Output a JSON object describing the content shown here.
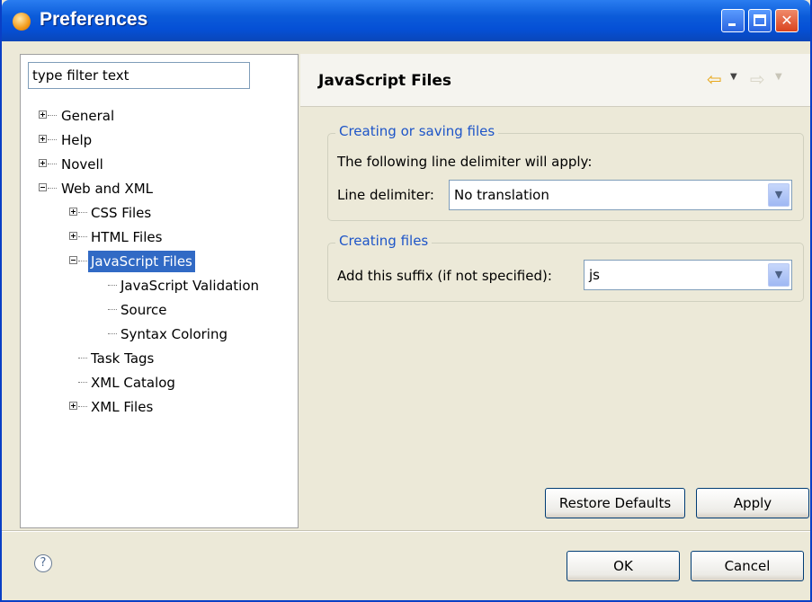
{
  "window": {
    "title": "Preferences",
    "colors": {
      "titlebar": "#0550d6",
      "selection": "#316ac5",
      "group_title": "#1e55c8",
      "face": "#ece9d8"
    }
  },
  "filter": {
    "value": "type filter text"
  },
  "tree": {
    "items": [
      {
        "label": "General",
        "expander": "plus"
      },
      {
        "label": "Help",
        "expander": "plus"
      },
      {
        "label": "Novell",
        "expander": "plus"
      },
      {
        "label": "Web and XML",
        "expander": "minus"
      },
      {
        "label": "CSS Files",
        "expander": "plus"
      },
      {
        "label": "HTML Files",
        "expander": "plus"
      },
      {
        "label": "JavaScript Files",
        "expander": "minus",
        "selected": true
      },
      {
        "label": "JavaScript Validation"
      },
      {
        "label": "Source"
      },
      {
        "label": "Syntax Coloring"
      },
      {
        "label": "Task Tags"
      },
      {
        "label": "XML Catalog"
      },
      {
        "label": "XML Files",
        "expander": "plus"
      }
    ]
  },
  "page": {
    "title": "JavaScript Files",
    "nav": {
      "back_icon": "back-arrow-icon",
      "forward_icon": "forward-arrow-icon"
    }
  },
  "groups": {
    "saving": {
      "title": "Creating or saving files",
      "description": "The following line delimiter will apply:",
      "delimiter_label": "Line delimiter:",
      "delimiter_value": "No translation"
    },
    "creating": {
      "title": "Creating files",
      "suffix_label": "Add this suffix (if not specified):",
      "suffix_value": "js"
    }
  },
  "buttons": {
    "restore_defaults": "Restore Defaults",
    "apply": "Apply",
    "ok": "OK",
    "cancel": "Cancel"
  },
  "help": {
    "glyph": "?"
  }
}
